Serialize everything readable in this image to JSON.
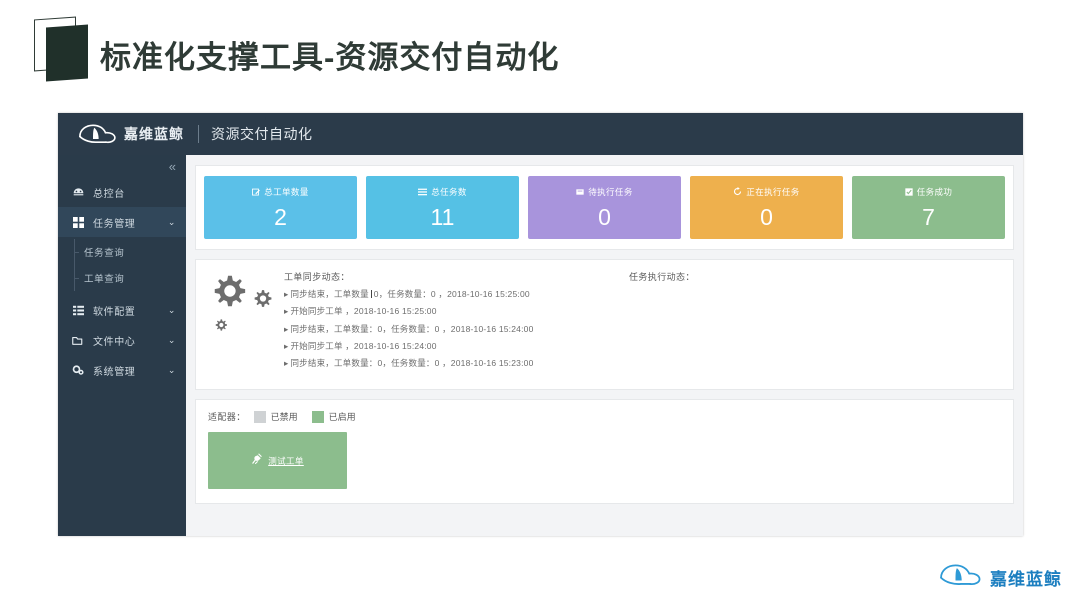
{
  "slide": {
    "title": "标准化支撑工具-资源交付自动化",
    "mark_icon": "document-stack-icon"
  },
  "app": {
    "brand": "嘉维蓝鲸",
    "brand_logo_icon": "whale-logo-icon",
    "subtitle": "资源交付自动化",
    "collapse_icon": "double-chevron-left-icon"
  },
  "sidebar": {
    "items": [
      {
        "label": "总控台",
        "icon": "dashboard-icon",
        "caret": "",
        "active": false
      },
      {
        "label": "任务管理",
        "icon": "grid-icon",
        "caret": "⌄",
        "active": true
      },
      {
        "label": "软件配置",
        "icon": "list-blocks-icon",
        "caret": "⌄",
        "active": false
      },
      {
        "label": "文件中心",
        "icon": "folder-open-icon",
        "caret": "⌄",
        "active": false
      },
      {
        "label": "系统管理",
        "icon": "gears-icon",
        "caret": "⌄",
        "active": false
      }
    ],
    "subitems": [
      {
        "label": "任务查询"
      },
      {
        "label": "工单查询"
      }
    ]
  },
  "cards": [
    {
      "label": "总工单数量",
      "value": "2",
      "color": "#5bc0e8",
      "icon": "edit-square-icon"
    },
    {
      "label": "总任务数",
      "value": "11",
      "color": "#55c1e5",
      "icon": "list-lines-icon"
    },
    {
      "label": "待执行任务",
      "value": "0",
      "color": "#a894dc",
      "icon": "inbox-icon"
    },
    {
      "label": "正在执行任务",
      "value": "0",
      "color": "#eeb04d",
      "icon": "refresh-icon"
    },
    {
      "label": "任务成功",
      "value": "7",
      "color": "#8cbd8d",
      "icon": "check-square-icon"
    }
  ],
  "log": {
    "gears_icon": "gears-cluster-icon",
    "left_heading": "工单同步动态：",
    "right_heading": "任务执行动态：",
    "entries": [
      {
        "pre": "同步结束，工单数量",
        "post": "0，任务数量：0 ，2018-10-16 15:25:00",
        "cursor": true
      },
      {
        "pre": "开始同步工单 ，2018-10-16 15:25:00",
        "post": "",
        "cursor": false
      },
      {
        "pre": "同步结束，工单数量：0，任务数量：0 ，2018-10-16 15:24:00",
        "post": "",
        "cursor": false
      },
      {
        "pre": "开始同步工单 ，2018-10-16 15:24:00",
        "post": "",
        "cursor": false
      },
      {
        "pre": "同步结束，工单数量：0，任务数量：0 ，2018-10-16 15:23:00",
        "post": "",
        "cursor": false
      }
    ],
    "bullet": "▸"
  },
  "adapter": {
    "filter_label": "适配器：",
    "disabled_label": "已禁用",
    "enabled_label": "已启用",
    "disabled_color": "#cfd2d4",
    "enabled_color": "#8cbd8d",
    "tile_label": "测试工单",
    "tile_icon": "plug-icon"
  },
  "footer": {
    "logo_icon": "whale-logo-icon",
    "brand": "嘉维蓝鲸",
    "brand_color": "#1d7fc0"
  }
}
